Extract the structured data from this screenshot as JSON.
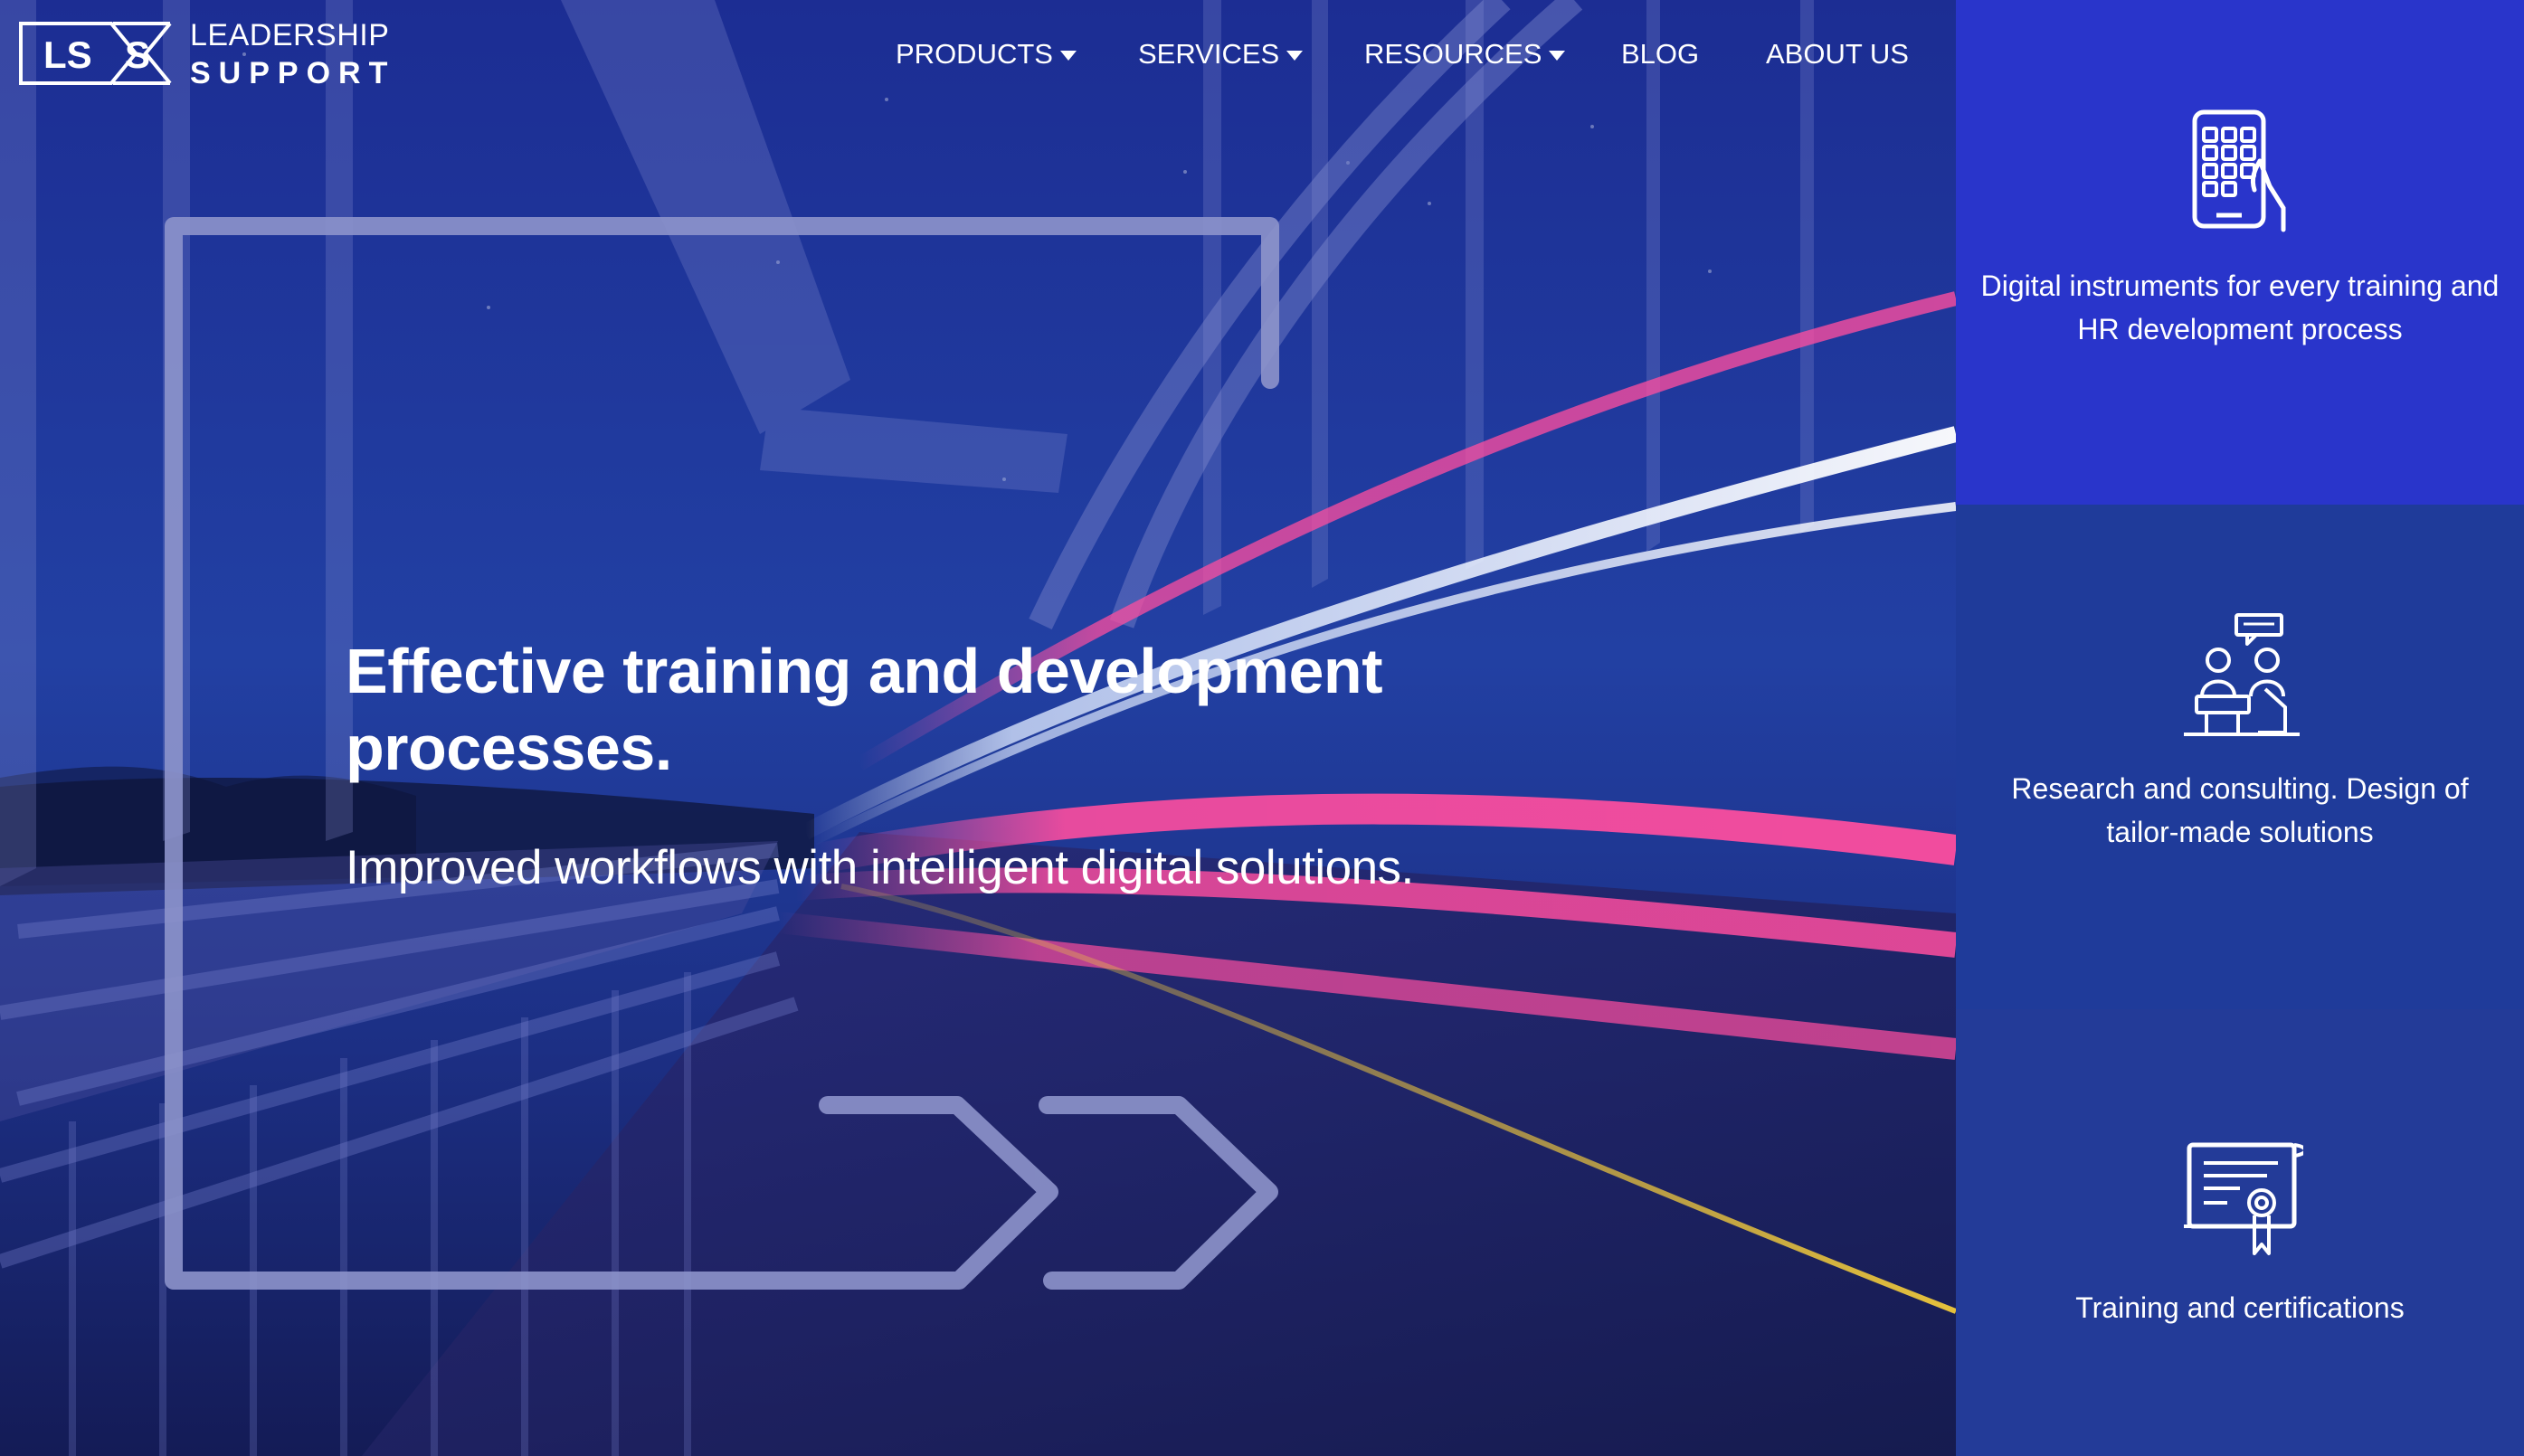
{
  "brand": {
    "logo_mark": "LS>S",
    "name_top": "LEADERSHIP",
    "name_bottom": "SUPPORT"
  },
  "nav": {
    "items": [
      {
        "label": "PRODUCTS",
        "has_dropdown": true
      },
      {
        "label": "SERVICES",
        "has_dropdown": true
      },
      {
        "label": "RESOURCES",
        "has_dropdown": true
      },
      {
        "label": "BLOG",
        "has_dropdown": false
      },
      {
        "label": "ABOUT US",
        "has_dropdown": false
      }
    ]
  },
  "hero": {
    "headline": "Effective training and development processes.",
    "subheadline": "Improved workflows with intelligent digital solutions."
  },
  "sidebar": {
    "cards": [
      {
        "icon": "tablet-touch-icon",
        "text": "Digital instruments for every training and HR development process",
        "background": "#2935cb"
      },
      {
        "icon": "consulting-meeting-icon",
        "text": "Research and consulting. Design of tailor-made solutions",
        "background": "#1f3b9a"
      },
      {
        "icon": "certificate-icon",
        "text": "Training and certifications",
        "background": "#233b98"
      }
    ]
  },
  "colors": {
    "hero_overlay": "#1e3597",
    "accent_pink": "#ff4f9f",
    "accent_gold": "#f0c63f",
    "text": "#ffffff"
  }
}
